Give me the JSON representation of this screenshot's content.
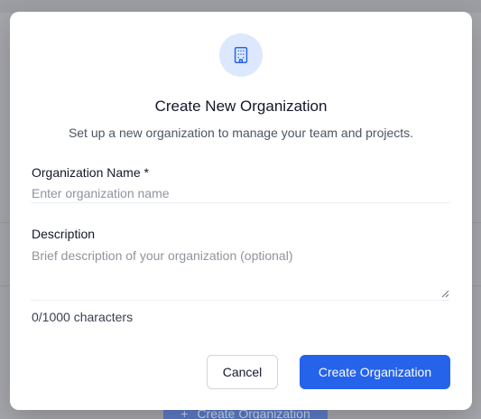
{
  "background": {
    "button_label": "Create Organization",
    "button_icon": "plus-icon"
  },
  "modal": {
    "icon": "building-icon",
    "title": "Create New Organization",
    "subtitle": "Set up a new organization to manage your team and projects.",
    "name_field": {
      "label": "Organization Name *",
      "value": "",
      "placeholder": "Enter organization name"
    },
    "description_field": {
      "label": "Description",
      "value": "",
      "placeholder": "Brief description of your organization (optional)",
      "char_count": "0/1000 characters"
    },
    "cancel_label": "Cancel",
    "submit_label": "Create Organization"
  },
  "colors": {
    "primary": "#2563eb",
    "icon_bg": "#dbe8fd",
    "overlay": "#a5a6ab"
  }
}
